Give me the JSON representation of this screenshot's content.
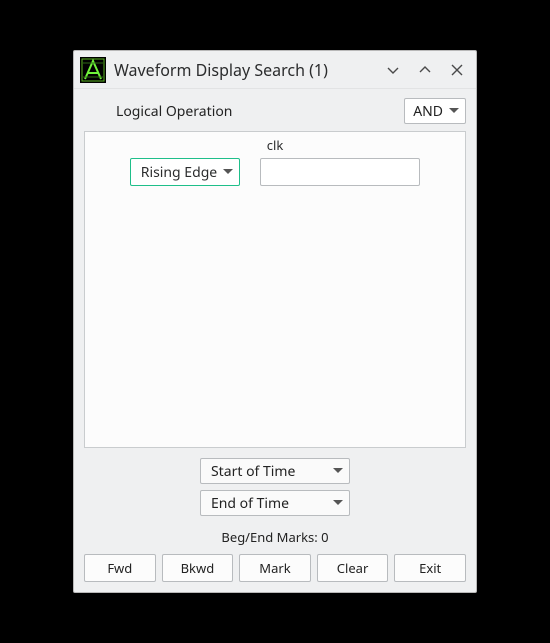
{
  "window": {
    "title": "Waveform Display Search (1)"
  },
  "logical_op": {
    "label": "Logical Operation",
    "selected": "AND"
  },
  "signal": {
    "name": "clk",
    "edge": "Rising Edge",
    "value": ""
  },
  "time_range": {
    "start": "Start of Time",
    "end": "End of Time"
  },
  "marks_label": "Beg/End Marks: 0",
  "buttons": {
    "fwd": "Fwd",
    "bkwd": "Bkwd",
    "mark": "Mark",
    "clear": "Clear",
    "exit": "Exit"
  }
}
